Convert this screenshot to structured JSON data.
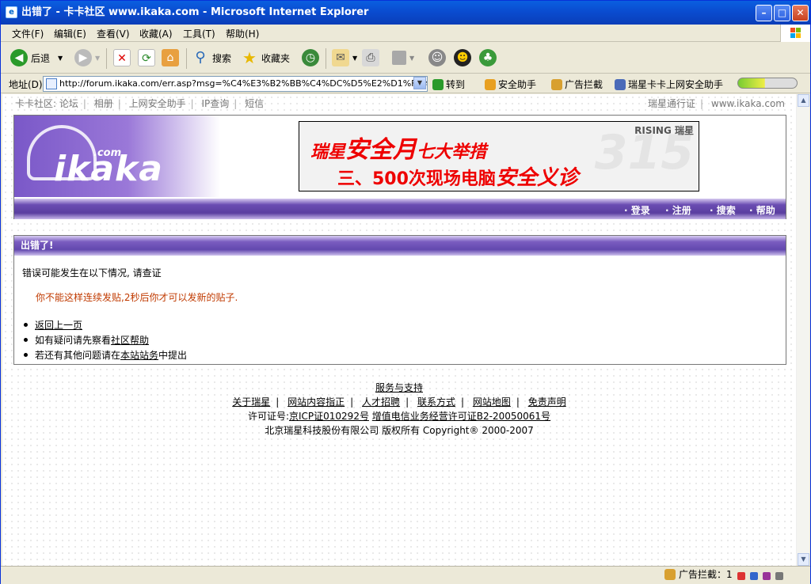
{
  "window": {
    "title": "出错了 - 卡卡社区 www.ikaka.com - Microsoft Internet Explorer"
  },
  "menubar": {
    "items": [
      "文件(F)",
      "编辑(E)",
      "查看(V)",
      "收藏(A)",
      "工具(T)",
      "帮助(H)"
    ]
  },
  "toolbar": {
    "back_label": "后退",
    "search_label": "搜索",
    "favorites_label": "收藏夹"
  },
  "addressbar": {
    "label": "地址(D)",
    "url": "http://forum.ikaka.com/err.asp?msg=%C4%E3%B2%BB%C4%DC%D5%E2%D1%F9%C1%",
    "go_label": "转到",
    "plugins": [
      "安全助手",
      "广告拦截",
      "瑞星卡卡上网安全助手"
    ]
  },
  "topnav": {
    "left": [
      "卡卡社区: 论坛",
      "相册",
      "上网安全助手",
      "IP查询",
      "短信"
    ],
    "right": [
      "瑞星通行证",
      "www.ikaka.com"
    ]
  },
  "header": {
    "logo_text": "ikaka",
    "logo_suffix": ".com",
    "banner_line1_a": "瑞星",
    "banner_line1_b": "安全月",
    "banner_line1_c": "七大举措",
    "banner_line2_a": "三、500次现场电脑",
    "banner_line2_b": "安全义诊",
    "banner_brand": "RISING 瑞星",
    "banner_bg": "315",
    "nav": [
      "· 登录",
      "· 注册",
      "· 搜索",
      "· 帮助"
    ]
  },
  "error": {
    "title": "出错了!",
    "intro": "错误可能发生在以下情况, 请查证",
    "message": "你不能这样连续发贴,2秒后你才可以发新的贴子.",
    "back_link": "返回上一页",
    "help_prefix": "如有疑问请先察看",
    "help_link": "社区帮助",
    "report_prefix": "若还有其他问题请在",
    "report_link": "本站站务",
    "report_suffix": "中提出"
  },
  "footer": {
    "service": "服务与支持",
    "links": [
      "关于瑞星",
      "网站内容指正",
      "人才招聘",
      "联系方式",
      "网站地图",
      "免责声明"
    ],
    "license_prefix": "许可证号:",
    "icp": "京ICP证010292号",
    "icp2": "增值电信业务经营许可证B2-20050061号",
    "copyright": "北京瑞星科技股份有限公司  版权所有 Copyright® 2000-2007"
  },
  "statusbar": {
    "adblock": "广告拦截：1"
  },
  "colors": {
    "title_blue": "#0a4cd0",
    "brand_purple": "#6a4cb2",
    "error_red": "#c03a00"
  }
}
